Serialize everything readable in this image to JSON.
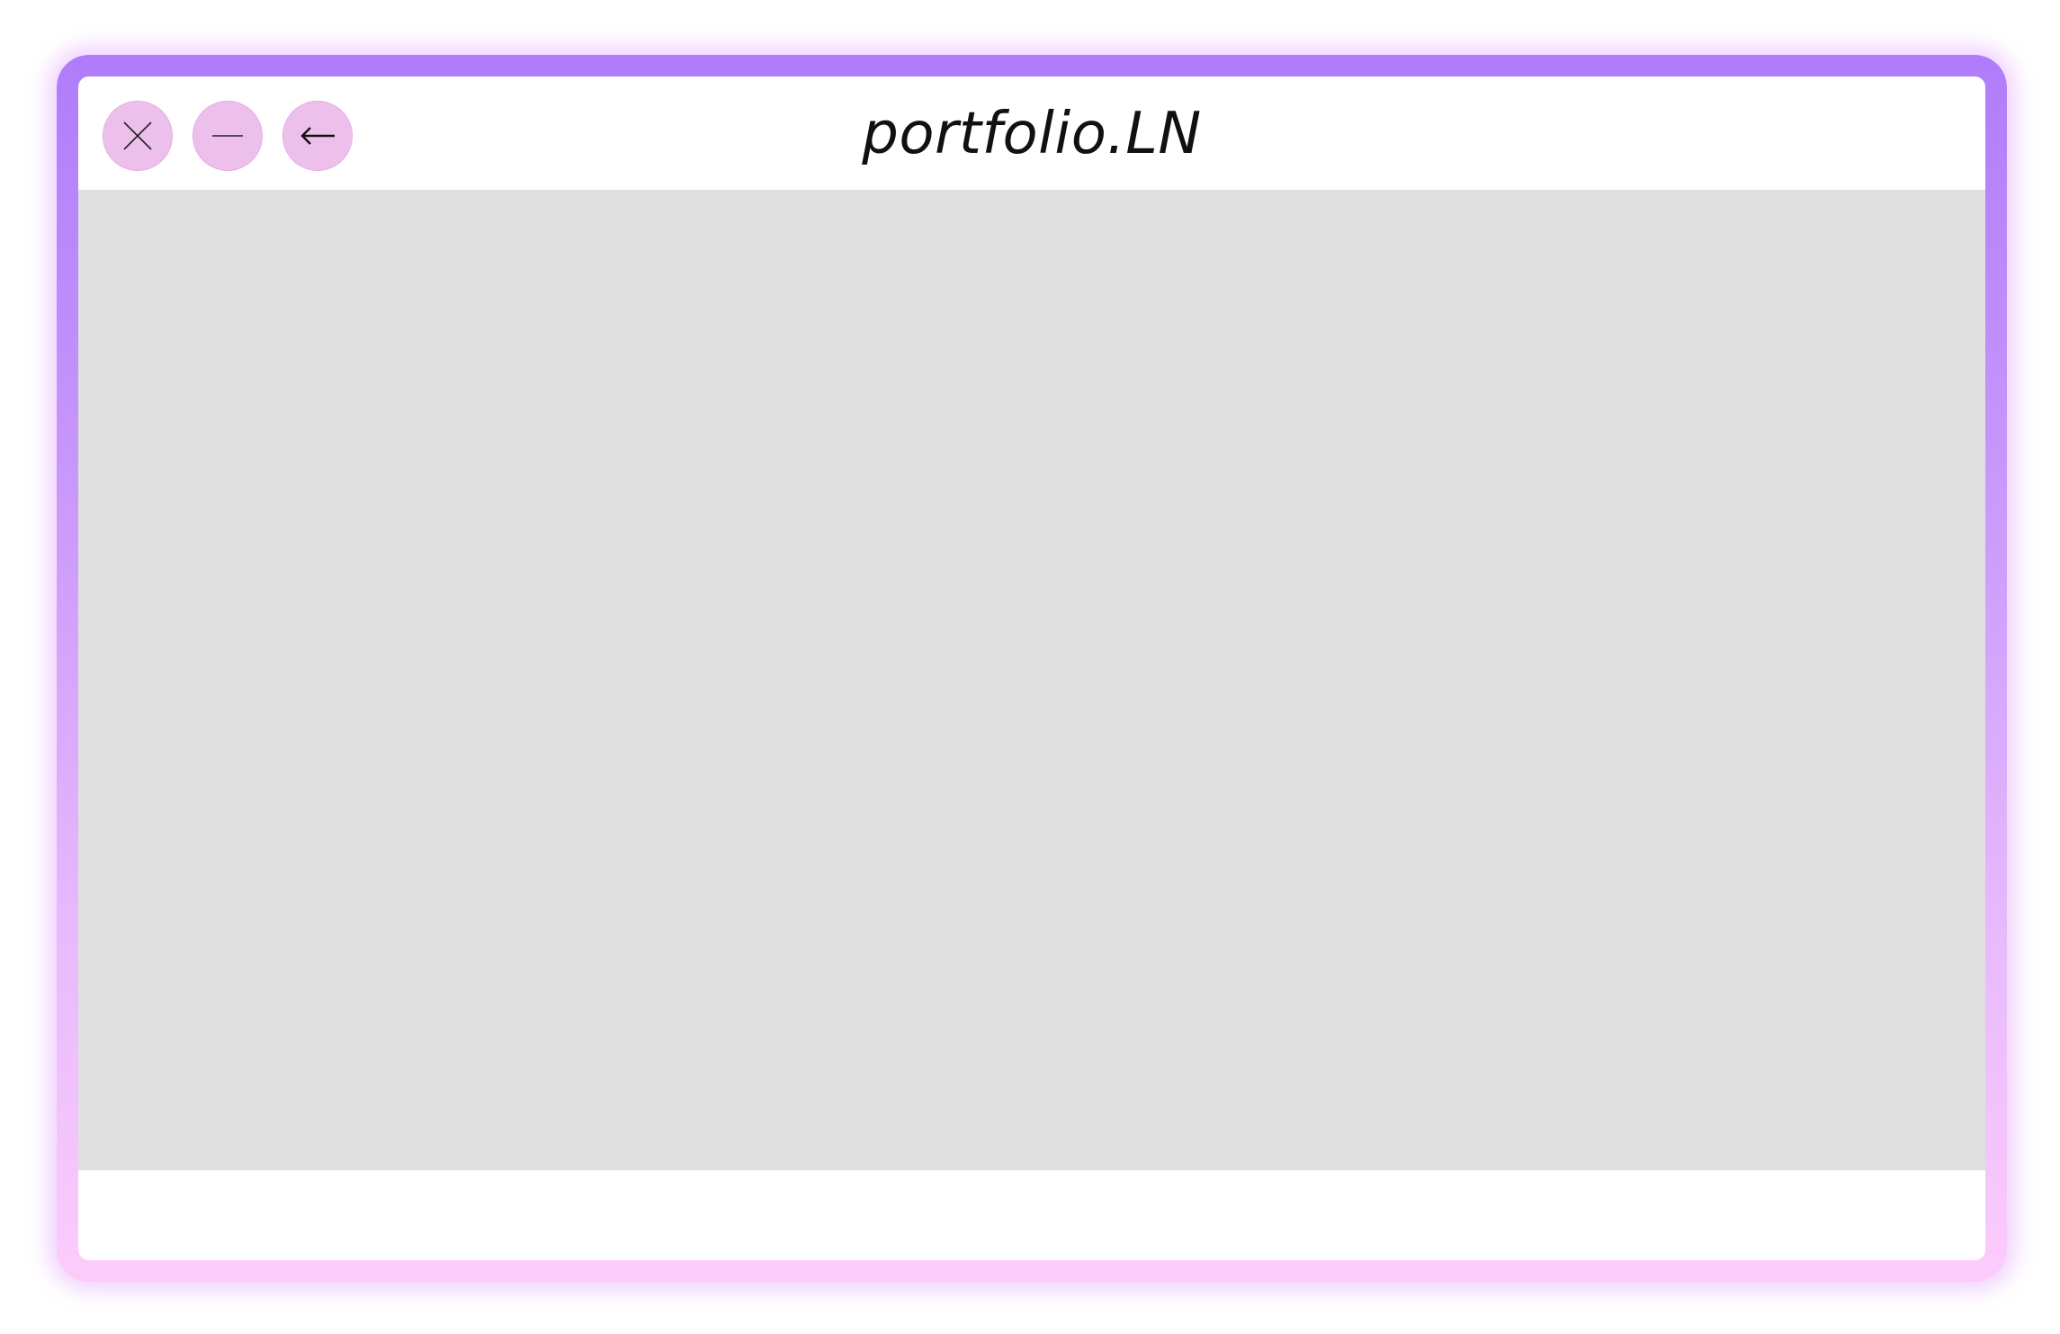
{
  "window": {
    "title": "portfolio.LN",
    "frame_gradient": [
      "#b07cfb",
      "#fbccfb"
    ],
    "button_color": "#ecc0ea",
    "content_background": "#e0e0e0"
  },
  "controls": [
    {
      "name": "close",
      "icon": "close-icon"
    },
    {
      "name": "minimize",
      "icon": "minimize-icon"
    },
    {
      "name": "back",
      "icon": "arrow-left-icon"
    }
  ]
}
